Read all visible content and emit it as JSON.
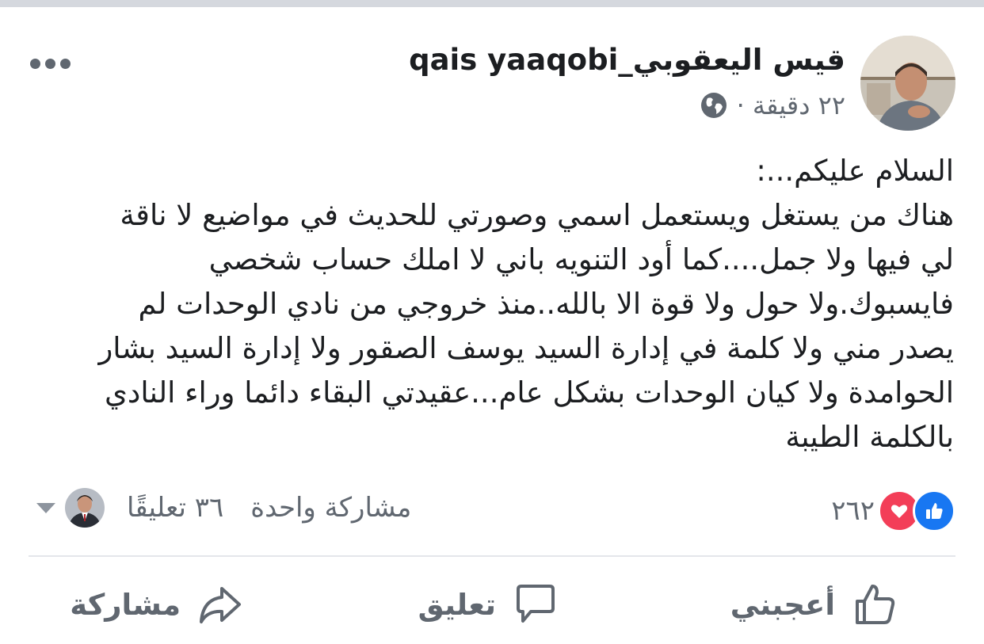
{
  "post": {
    "author": "qais yaaqobi_قيس اليعقوبي",
    "time": "٢٢ دقيقة ·",
    "text_lines": [
      "السلام عليكم...:",
      "هناك من يستغل ويستعمل اسمي وصورتي للحديث في مواضيع لا ناقة",
      "لي فيها ولا جمل....كما أود التنويه باني لا املك حساب شخصي",
      "فايسبوك.ولا حول ولا قوة الا بالله..منذ خروجي من نادي الوحدات لم",
      "يصدر مني ولا كلمة في إدارة السيد يوسف الصقور ولا إدارة السيد بشار",
      "الحوامدة ولا كيان الوحدات بشكل عام...عقيدتي البقاء دائما وراء النادي",
      "بالكلمة الطيبة"
    ]
  },
  "footer": {
    "reactions_count": "٢٦٢",
    "comments": "٣٦ تعليقًا",
    "shares": "مشاركة واحدة"
  },
  "actions": {
    "like": "أعجبني",
    "comment": "تعليق",
    "share": "مشاركة"
  },
  "icons": {
    "more": "more-horizontal-icon",
    "privacy": "globe-icon",
    "like_reaction": "thumbs-up-icon",
    "love_reaction": "heart-icon"
  },
  "colors": {
    "like_blue": "#1877f2",
    "love_red": "#f33e58",
    "secondary_text": "#606770"
  }
}
